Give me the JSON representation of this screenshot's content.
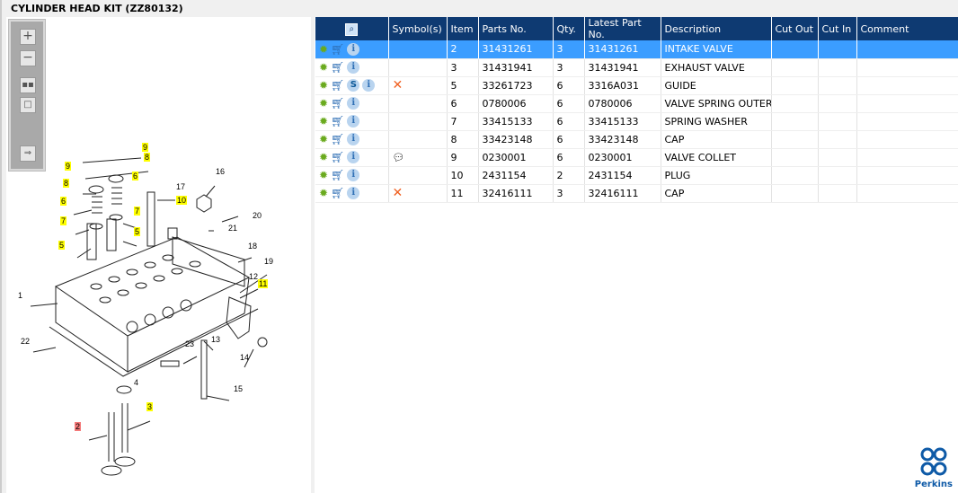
{
  "title": "CYLINDER HEAD KIT (ZZ80132)",
  "toolbar": {
    "zoom_in": "zoom-in-icon",
    "zoom_out": "zoom-out-icon",
    "fit": "fit-icon",
    "actual": "actual-size-icon",
    "export": "export-icon"
  },
  "callouts": [
    {
      "label": "9",
      "hl": "y"
    },
    {
      "label": "8",
      "hl": "y"
    },
    {
      "label": "9",
      "hl": "y"
    },
    {
      "label": "8",
      "hl": "y"
    },
    {
      "label": "6",
      "hl": "y"
    },
    {
      "label": "6",
      "hl": "y"
    },
    {
      "label": "7",
      "hl": "y"
    },
    {
      "label": "7",
      "hl": "y"
    },
    {
      "label": "5",
      "hl": "y"
    },
    {
      "label": "5",
      "hl": "y"
    },
    {
      "label": "10",
      "hl": "y"
    },
    {
      "label": "17",
      "hl": ""
    },
    {
      "label": "16",
      "hl": ""
    },
    {
      "label": "20",
      "hl": ""
    },
    {
      "label": "21",
      "hl": ""
    },
    {
      "label": "18",
      "hl": ""
    },
    {
      "label": "19",
      "hl": ""
    },
    {
      "label": "12",
      "hl": ""
    },
    {
      "label": "11",
      "hl": "y"
    },
    {
      "label": "1",
      "hl": ""
    },
    {
      "label": "22",
      "hl": ""
    },
    {
      "label": "13",
      "hl": ""
    },
    {
      "label": "23",
      "hl": ""
    },
    {
      "label": "14",
      "hl": ""
    },
    {
      "label": "4",
      "hl": ""
    },
    {
      "label": "15",
      "hl": ""
    },
    {
      "label": "3",
      "hl": "y"
    },
    {
      "label": "2",
      "hl": "r"
    }
  ],
  "table": {
    "headers": [
      "",
      "Symbol(s)",
      "Item",
      "Parts No.",
      "Qty.",
      "Latest Part No.",
      "Description",
      "Cut Out",
      "Cut In",
      "Comment"
    ],
    "rows": [
      {
        "item": "2",
        "part": "31431261",
        "qty": "3",
        "latest": "31431261",
        "desc": "INTAKE VALVE",
        "s": false,
        "sym": ""
      },
      {
        "item": "3",
        "part": "31431941",
        "qty": "3",
        "latest": "31431941",
        "desc": "EXHAUST VALVE",
        "s": false,
        "sym": ""
      },
      {
        "item": "5",
        "part": "33261723",
        "qty": "6",
        "latest": "3316A031",
        "desc": "GUIDE",
        "s": true,
        "sym": "x"
      },
      {
        "item": "6",
        "part": "0780006",
        "qty": "6",
        "latest": "0780006",
        "desc": "VALVE SPRING OUTER",
        "s": false,
        "sym": ""
      },
      {
        "item": "7",
        "part": "33415133",
        "qty": "6",
        "latest": "33415133",
        "desc": "SPRING WASHER",
        "s": false,
        "sym": ""
      },
      {
        "item": "8",
        "part": "33423148",
        "qty": "6",
        "latest": "33423148",
        "desc": "CAP",
        "s": false,
        "sym": ""
      },
      {
        "item": "9",
        "part": "0230001",
        "qty": "6",
        "latest": "0230001",
        "desc": "VALVE COLLET",
        "s": false,
        "sym": "note"
      },
      {
        "item": "10",
        "part": "2431154",
        "qty": "2",
        "latest": "2431154",
        "desc": "PLUG",
        "s": false,
        "sym": ""
      },
      {
        "item": "11",
        "part": "32416111",
        "qty": "3",
        "latest": "32416111",
        "desc": "CAP",
        "s": false,
        "sym": "x"
      }
    ],
    "selected_index": 0
  },
  "brand": "Perkins",
  "colors": {
    "header": "#0e3a72",
    "selected": "#3b9dff",
    "highlight": "#ffff00"
  }
}
